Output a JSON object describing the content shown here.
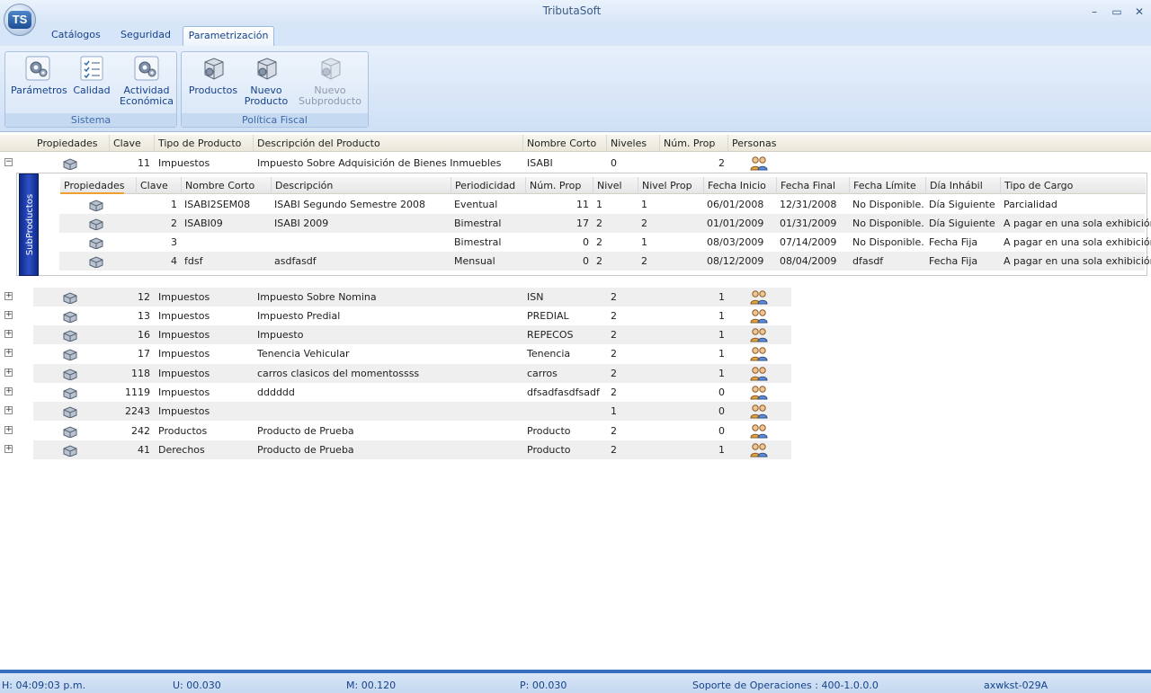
{
  "window": {
    "title": "TributaSoft",
    "logo_text": "TS",
    "minimize": "–",
    "maximize": "▭",
    "close": "✕"
  },
  "tabs": [
    {
      "label": "Catálogos"
    },
    {
      "label": "Seguridad"
    },
    {
      "label": "Parametrización"
    }
  ],
  "ribbon": {
    "groups": [
      {
        "label": "Sistema",
        "buttons": [
          {
            "label": "Parámetros"
          },
          {
            "label": "Calidad"
          },
          {
            "label": "Actividad Económica"
          }
        ]
      },
      {
        "label": "Política Fiscal",
        "buttons": [
          {
            "label": "Productos"
          },
          {
            "label": "Nuevo Producto"
          },
          {
            "label": "Nuevo Subproducto"
          }
        ]
      }
    ]
  },
  "grid": {
    "columns": [
      "Propiedades",
      "Clave",
      "Tipo de Producto",
      "Descripción del Producto",
      "Nombre Corto",
      "Niveles",
      "Núm. Prop",
      "Personas"
    ],
    "expanded_row": {
      "expander": "−",
      "clave": "11",
      "tipo": "Impuestos",
      "descripcion": "Impuesto Sobre Adquisición de Bienes Inmuebles",
      "nombre_corto": "ISABI",
      "niveles": "0",
      "num_prop": "2"
    },
    "rows": [
      {
        "expander": "+",
        "clave": "12",
        "tipo": "Impuestos",
        "descripcion": "Impuesto Sobre Nomina",
        "nombre_corto": "ISN",
        "niveles": "2",
        "num_prop": "1"
      },
      {
        "expander": "+",
        "clave": "13",
        "tipo": "Impuestos",
        "descripcion": "Impuesto Predial",
        "nombre_corto": "PREDIAL",
        "niveles": "2",
        "num_prop": "1"
      },
      {
        "expander": "+",
        "clave": "16",
        "tipo": "Impuestos",
        "descripcion": "Impuesto",
        "nombre_corto": "REPECOS",
        "niveles": "2",
        "num_prop": "1"
      },
      {
        "expander": "+",
        "clave": "17",
        "tipo": "Impuestos",
        "descripcion": "Tenencia Vehicular",
        "nombre_corto": "Tenencia",
        "niveles": "2",
        "num_prop": "1"
      },
      {
        "expander": "+",
        "clave": "118",
        "tipo": "Impuestos",
        "descripcion": "carros clasicos del momentossss",
        "nombre_corto": "carros",
        "niveles": "2",
        "num_prop": "1"
      },
      {
        "expander": "+",
        "clave": "1119",
        "tipo": "Impuestos",
        "descripcion": "dddddd",
        "nombre_corto": "dfsadfasdfsadf",
        "niveles": "2",
        "num_prop": "0"
      },
      {
        "expander": "+",
        "clave": "2243",
        "tipo": "Impuestos",
        "descripcion": "",
        "nombre_corto": "",
        "niveles": "1",
        "num_prop": "0"
      },
      {
        "expander": "+",
        "clave": "242",
        "tipo": "Productos",
        "descripcion": "Producto de Prueba",
        "nombre_corto": "Producto",
        "niveles": "2",
        "num_prop": "0"
      },
      {
        "expander": "+",
        "clave": "41",
        "tipo": "Derechos",
        "descripcion": "Producto de Prueba",
        "nombre_corto": "Producto",
        "niveles": "2",
        "num_prop": "1"
      }
    ]
  },
  "subgrid": {
    "tab_label": "SubProductos",
    "columns": [
      "Propiedades",
      "Clave",
      "Nombre Corto",
      "Descripción",
      "Periodicidad",
      "Núm. Prop",
      "Nivel",
      "Nivel Prop",
      "Fecha Inicio",
      "Fecha Final",
      "Fecha Límite",
      "Día Inhábil",
      "Tipo de Cargo"
    ],
    "rows": [
      {
        "clave": "1",
        "nombre_corto": "ISABI2SEM08",
        "descripcion": "ISABI Segundo Semestre 2008",
        "periodicidad": "Eventual",
        "num_prop": "11",
        "nivel": "1",
        "nivel_prop": "1",
        "fecha_inicio": "06/01/2008",
        "fecha_final": "12/31/2008",
        "fecha_limite": "No Disponible.",
        "dia_inhabil": "Día Siguiente",
        "tipo_cargo": "Parcialidad"
      },
      {
        "clave": "2",
        "nombre_corto": "ISABI09",
        "descripcion": "ISABI 2009",
        "periodicidad": "Bimestral",
        "num_prop": "17",
        "nivel": "2",
        "nivel_prop": "2",
        "fecha_inicio": "01/01/2009",
        "fecha_final": "01/31/2009",
        "fecha_limite": "No Disponible.",
        "dia_inhabil": "Día Siguiente",
        "tipo_cargo": "A pagar en una sola exhibición"
      },
      {
        "clave": "3",
        "nombre_corto": "",
        "descripcion": "",
        "periodicidad": "Bimestral",
        "num_prop": "0",
        "nivel": "2",
        "nivel_prop": "1",
        "fecha_inicio": "08/03/2009",
        "fecha_final": "07/14/2009",
        "fecha_limite": "No Disponible.",
        "dia_inhabil": "Fecha Fija",
        "tipo_cargo": "A pagar en una sola exhibición"
      },
      {
        "clave": "4",
        "nombre_corto": "fdsf",
        "descripcion": "asdfasdf",
        "periodicidad": "Mensual",
        "num_prop": "0",
        "nivel": "2",
        "nivel_prop": "2",
        "fecha_inicio": "08/12/2009",
        "fecha_final": "08/04/2009",
        "fecha_limite": "dfasdf",
        "dia_inhabil": "Fecha Fija",
        "tipo_cargo": "A pagar en una sola exhibición"
      }
    ]
  },
  "status": {
    "h": "H: 04:09:03 p.m.",
    "u": "U: 00.030",
    "m": "M: 00.120",
    "p": "P: 00.030",
    "soporte": "Soporte de Operaciones  :  400-1.0.0.0",
    "workstation": "axwkst-029A"
  },
  "icons": {
    "props": "box-gear-icon",
    "personas": "people-icon",
    "params": "gears-icon",
    "calidad": "checklist-icon",
    "actividad": "gears-icon",
    "productos": "cube-gear-icon"
  }
}
